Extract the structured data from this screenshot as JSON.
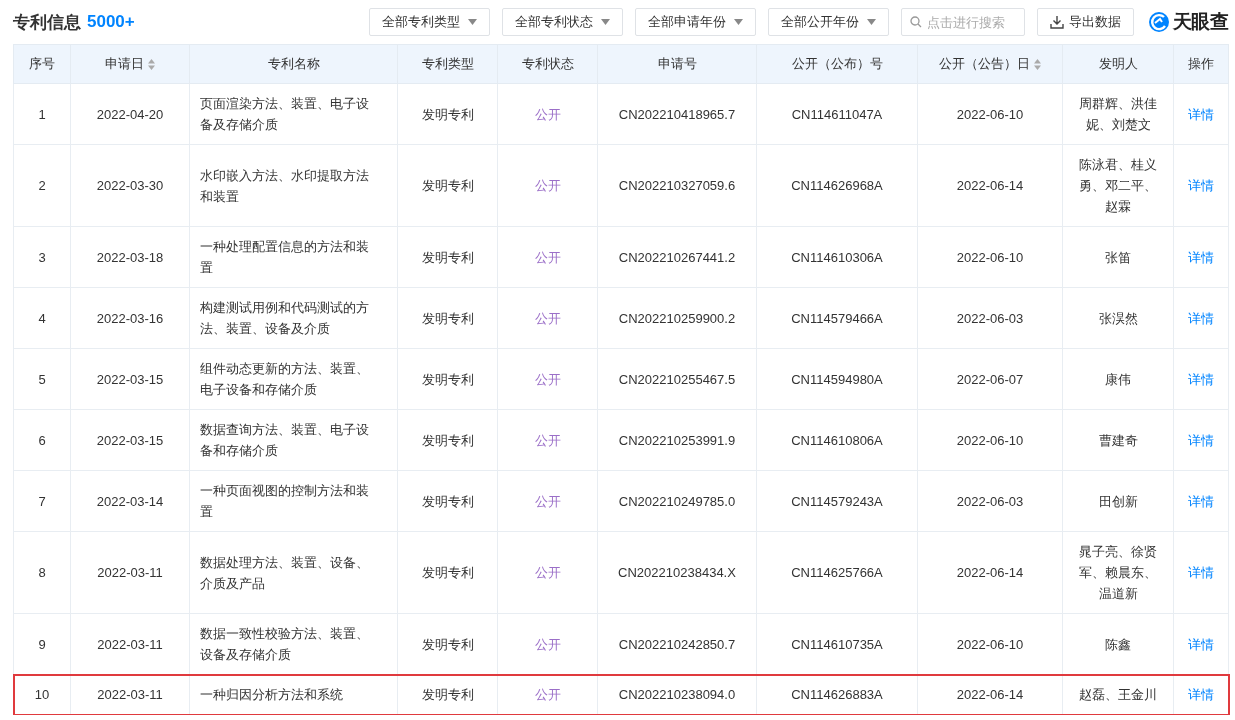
{
  "header": {
    "title": "专利信息",
    "count": "5000+"
  },
  "filters": [
    {
      "label": "全部专利类型"
    },
    {
      "label": "全部专利状态"
    },
    {
      "label": "全部申请年份"
    },
    {
      "label": "全部公开年份"
    }
  ],
  "search": {
    "placeholder": "点击进行搜索"
  },
  "export_button": {
    "label": "导出数据"
  },
  "brand": {
    "name": "天眼查"
  },
  "table": {
    "columns": [
      {
        "label": "序号",
        "sortable": false
      },
      {
        "label": "申请日",
        "sortable": true
      },
      {
        "label": "专利名称",
        "sortable": false
      },
      {
        "label": "专利类型",
        "sortable": false
      },
      {
        "label": "专利状态",
        "sortable": false
      },
      {
        "label": "申请号",
        "sortable": false
      },
      {
        "label": "公开（公布）号",
        "sortable": false
      },
      {
        "label": "公开（公告）日",
        "sortable": true
      },
      {
        "label": "发明人",
        "sortable": false
      },
      {
        "label": "操作",
        "sortable": false
      }
    ],
    "rows": [
      {
        "no": "1",
        "apply_date": "2022-04-20",
        "name": "页面渲染方法、装置、电子设备及存储介质",
        "type": "发明专利",
        "status": "公开",
        "apply_no": "CN202210418965.7",
        "pub_no": "CN114611047A",
        "pub_date": "2022-06-10",
        "inventors": "周群辉、洪佳妮、刘楚文",
        "action": "详情",
        "highlighted": false
      },
      {
        "no": "2",
        "apply_date": "2022-03-30",
        "name": "水印嵌入方法、水印提取方法和装置",
        "type": "发明专利",
        "status": "公开",
        "apply_no": "CN202210327059.6",
        "pub_no": "CN114626968A",
        "pub_date": "2022-06-14",
        "inventors": "陈泳君、桂义勇、邓二平、赵霖",
        "action": "详情",
        "highlighted": false
      },
      {
        "no": "3",
        "apply_date": "2022-03-18",
        "name": "一种处理配置信息的方法和装置",
        "type": "发明专利",
        "status": "公开",
        "apply_no": "CN202210267441.2",
        "pub_no": "CN114610306A",
        "pub_date": "2022-06-10",
        "inventors": "张笛",
        "action": "详情",
        "highlighted": false
      },
      {
        "no": "4",
        "apply_date": "2022-03-16",
        "name": "构建测试用例和代码测试的方法、装置、设备及介质",
        "type": "发明专利",
        "status": "公开",
        "apply_no": "CN202210259900.2",
        "pub_no": "CN114579466A",
        "pub_date": "2022-06-03",
        "inventors": "张淏然",
        "action": "详情",
        "highlighted": false
      },
      {
        "no": "5",
        "apply_date": "2022-03-15",
        "name": "组件动态更新的方法、装置、电子设备和存储介质",
        "type": "发明专利",
        "status": "公开",
        "apply_no": "CN202210255467.5",
        "pub_no": "CN114594980A",
        "pub_date": "2022-06-07",
        "inventors": "康伟",
        "action": "详情",
        "highlighted": false
      },
      {
        "no": "6",
        "apply_date": "2022-03-15",
        "name": "数据查询方法、装置、电子设备和存储介质",
        "type": "发明专利",
        "status": "公开",
        "apply_no": "CN202210253991.9",
        "pub_no": "CN114610806A",
        "pub_date": "2022-06-10",
        "inventors": "曹建奇",
        "action": "详情",
        "highlighted": false
      },
      {
        "no": "7",
        "apply_date": "2022-03-14",
        "name": "一种页面视图的控制方法和装置",
        "type": "发明专利",
        "status": "公开",
        "apply_no": "CN202210249785.0",
        "pub_no": "CN114579243A",
        "pub_date": "2022-06-03",
        "inventors": "田创新",
        "action": "详情",
        "highlighted": false
      },
      {
        "no": "8",
        "apply_date": "2022-03-11",
        "name": "数据处理方法、装置、设备、介质及产品",
        "type": "发明专利",
        "status": "公开",
        "apply_no": "CN202210238434.X",
        "pub_no": "CN114625766A",
        "pub_date": "2022-06-14",
        "inventors": "晁子亮、徐贤军、赖晨东、温道新",
        "action": "详情",
        "highlighted": false
      },
      {
        "no": "9",
        "apply_date": "2022-03-11",
        "name": "数据一致性校验方法、装置、设备及存储介质",
        "type": "发明专利",
        "status": "公开",
        "apply_no": "CN202210242850.7",
        "pub_no": "CN114610735A",
        "pub_date": "2022-06-10",
        "inventors": "陈鑫",
        "action": "详情",
        "highlighted": false
      },
      {
        "no": "10",
        "apply_date": "2022-03-11",
        "name": "一种归因分析方法和系统",
        "type": "发明专利",
        "status": "公开",
        "apply_no": "CN202210238094.0",
        "pub_no": "CN114626883A",
        "pub_date": "2022-06-14",
        "inventors": "赵磊、王金川",
        "action": "详情",
        "highlighted": true
      }
    ]
  }
}
